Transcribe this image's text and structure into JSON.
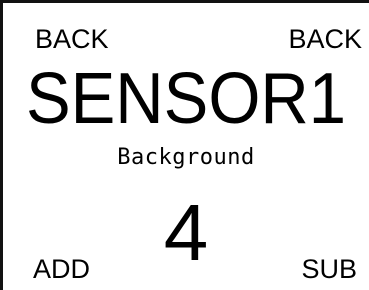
{
  "softkeys": {
    "top_left": "BACK",
    "top_right": "BACK",
    "bottom_left": "ADD",
    "bottom_right": "SUB"
  },
  "display": {
    "title": "SENSOR1",
    "subtitle": "Background",
    "value": "4"
  }
}
